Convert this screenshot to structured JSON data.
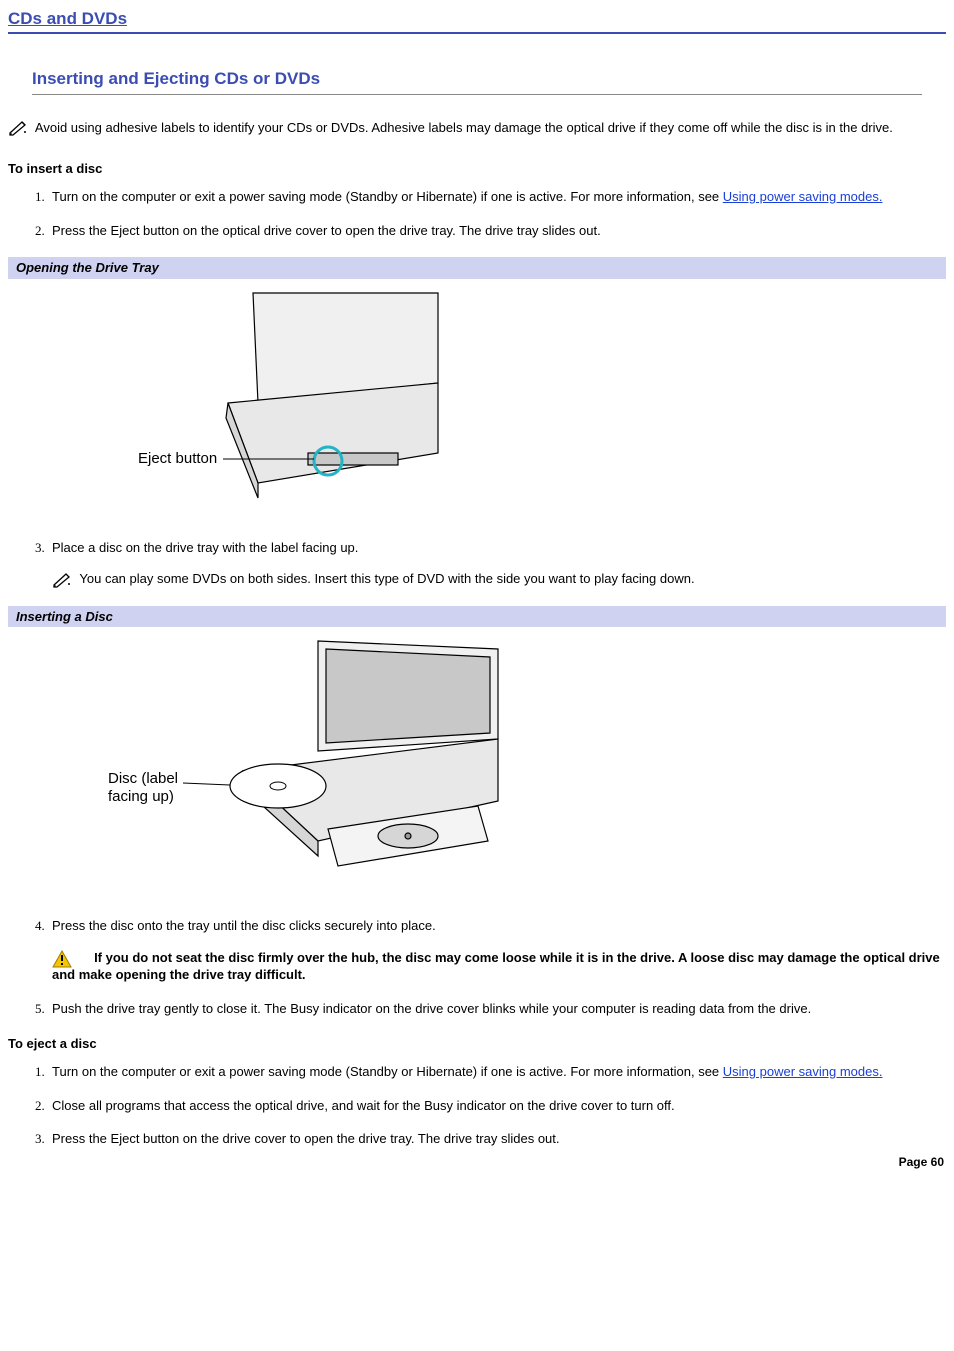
{
  "chapter_title": "CDs and DVDs",
  "section_title": "Inserting and Ejecting CDs or DVDs",
  "top_note": "Avoid using adhesive labels to identify your CDs or DVDs. Adhesive labels may damage the optical drive if they come off while the disc is in the drive.",
  "insert": {
    "heading": "To insert a disc",
    "step1_a": "Turn on the computer or exit a power saving mode (Standby or Hibernate) if one is active. For more information, see ",
    "step1_link": "Using power saving modes.",
    "step2": "Press the Eject button on the optical drive cover to open the drive tray. The drive tray slides out.",
    "fig1_caption": "Opening the Drive Tray",
    "fig1_label": "Eject button",
    "step3": "Place a disc on the drive tray with the label facing up.",
    "step3_note": "You can play some DVDs on both sides. Insert this type of DVD with the side you want to play facing down.",
    "fig2_caption": "Inserting a Disc",
    "fig2_label1": "Disc (label",
    "fig2_label2": "facing up)",
    "step4": "Press the disc onto the tray until the disc clicks securely into place.",
    "step4_warn": "If you do not seat the disc firmly over the hub, the disc may come loose while it is in the drive. A loose disc may damage the optical drive and make opening the drive tray difficult.",
    "step5": "Push the drive tray gently to close it. The Busy indicator on the drive cover blinks while your computer is reading data from the drive."
  },
  "eject": {
    "heading": "To eject a disc",
    "step1_a": "Turn on the computer or exit a power saving mode (Standby or Hibernate) if one is active. For more information, see ",
    "step1_link": "Using power saving modes.",
    "step2": "Close all programs that access the optical drive, and wait for the Busy indicator on the drive cover to turn off.",
    "step3": "Press the Eject button on the drive cover to open the drive tray. The drive tray slides out."
  },
  "page_label": "Page 60"
}
